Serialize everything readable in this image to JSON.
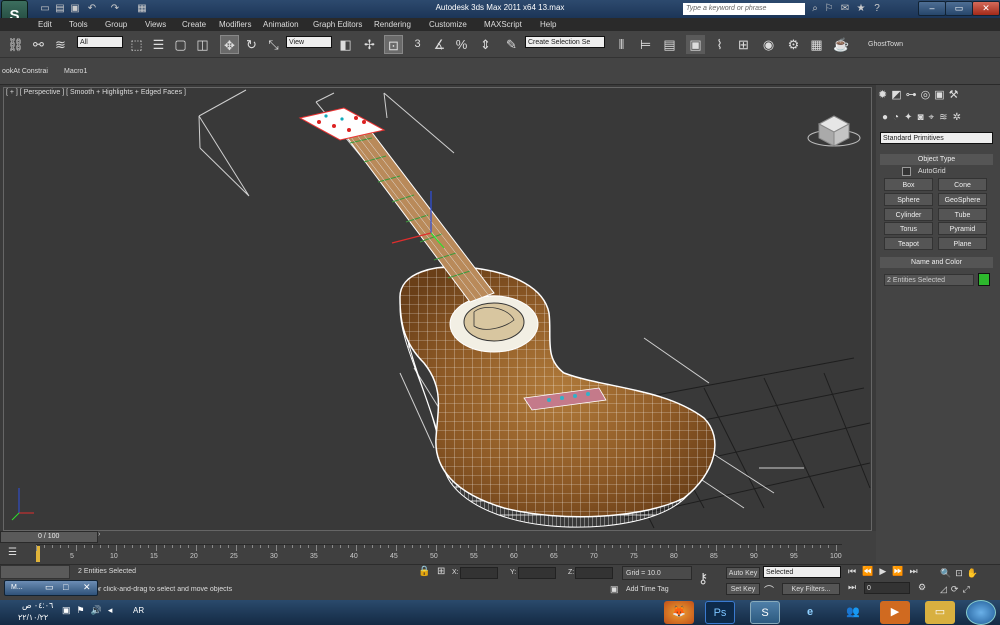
{
  "window": {
    "title": "Autodesk 3ds Max  2011 x64      13.max",
    "search_placeholder": "Type a keyword or phrase"
  },
  "menus": [
    "Edit",
    "Tools",
    "Group",
    "Views",
    "Create",
    "Modifiers",
    "Animation",
    "Graph Editors",
    "Rendering",
    "Customize",
    "MAXScript",
    "Help"
  ],
  "toolbar": {
    "filter_value": "All",
    "coord_value": "View",
    "selection_set_placeholder": "Create Selection Se",
    "three_label": "3"
  },
  "ribbon": {
    "items": [
      "ookAt Constrai",
      "Macro1"
    ],
    "ghosttown": "GhostTown"
  },
  "viewport": {
    "label": "[ + ] [ Perspective ] [ Smooth + Highlights + Edged Faces ]"
  },
  "command_panel": {
    "category": "Standard Primitives",
    "object_type_title": "Object Type",
    "autogrid": "AutoGrid",
    "buttons": [
      "Box",
      "Cone",
      "Sphere",
      "GeoSphere",
      "Cylinder",
      "Tube",
      "Torus",
      "Pyramid",
      "Teapot",
      "Plane"
    ],
    "name_color_title": "Name and Color",
    "name_value": "2 Entities Selected",
    "color": "#2db82d"
  },
  "timeline": {
    "frame_label": "0 / 100",
    "ticks": [
      "0",
      "5",
      "10",
      "15",
      "20",
      "25",
      "30",
      "35",
      "40",
      "45",
      "50",
      "55",
      "60",
      "65",
      "70",
      "75",
      "80",
      "85",
      "90",
      "95",
      "100"
    ]
  },
  "status": {
    "selected": "2 Entities Selected",
    "prompt": "Click or click-and-drag to select and move objects",
    "x_label": "X:",
    "y_label": "Y:",
    "z_label": "Z:",
    "grid": "Grid = 10.0",
    "add_time_tag": "Add Time Tag",
    "auto_key": "Auto Key",
    "set_key": "Set Key",
    "key_mode": "Selected",
    "key_filters": "Key Filters...",
    "frame_value": "0",
    "mini_listener": "M..."
  },
  "taskbar": {
    "lang": "AR",
    "time": "٠٤:٠٦ ص",
    "date": "٢٢/١٠/٢٢"
  }
}
